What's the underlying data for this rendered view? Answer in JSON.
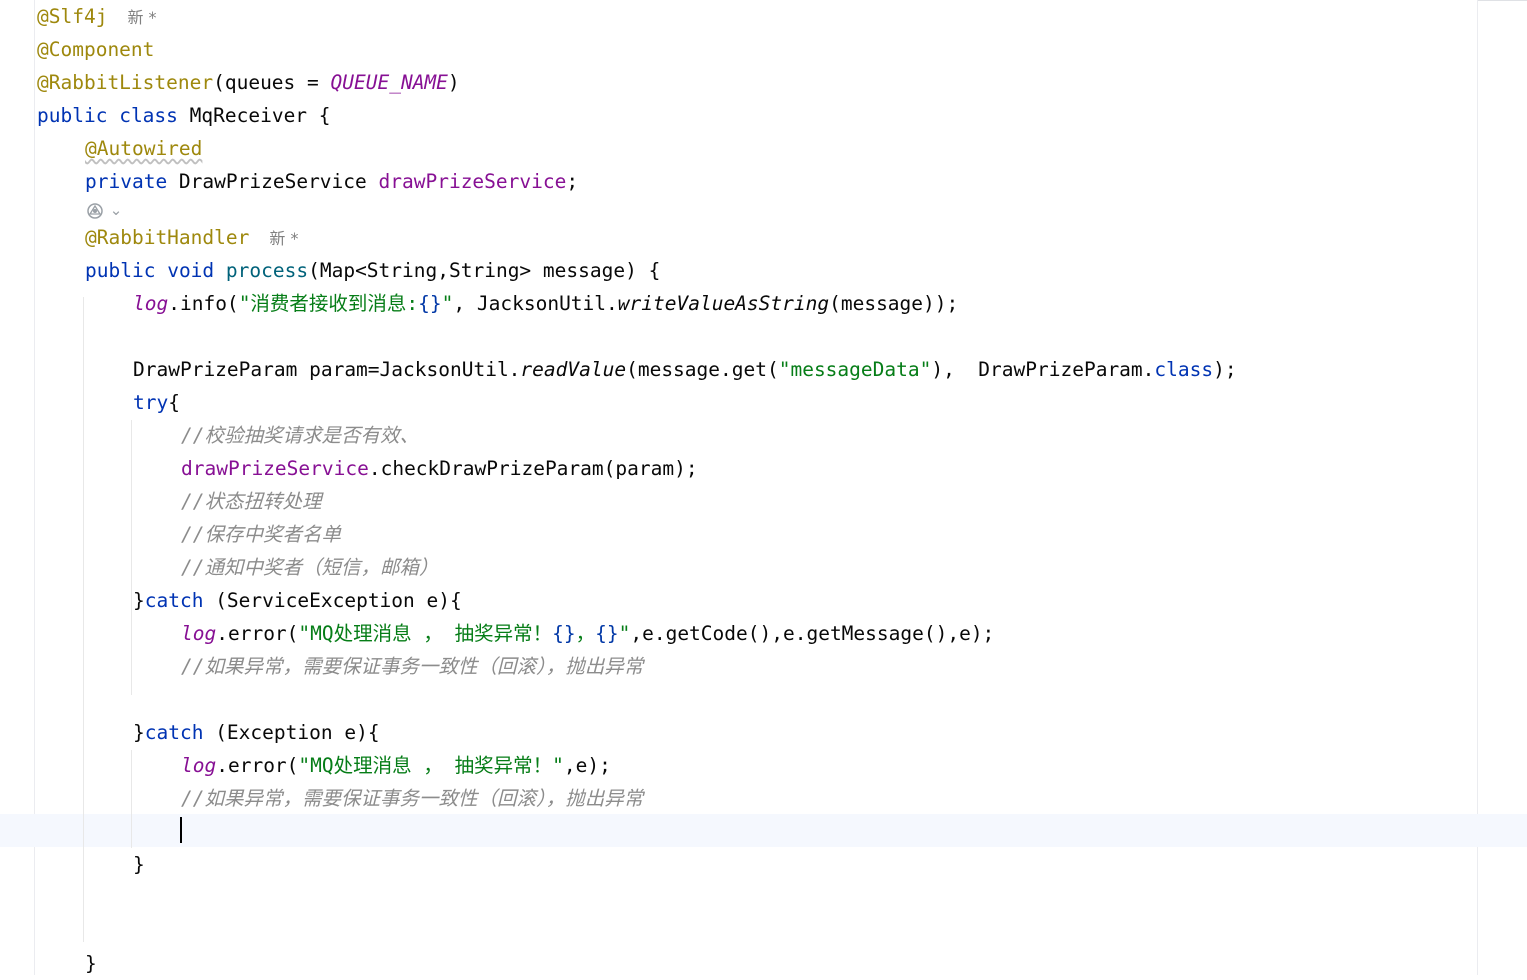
{
  "editor": {
    "inlay_new_1": "新 *",
    "inlay_new_2": "新 *",
    "lines": {
      "l1_ann": "@Slf4j",
      "l2_ann": "@Component",
      "l3_ann": "@RabbitListener",
      "l3_open": "(queues = ",
      "l3_const": "QUEUE_NAME",
      "l3_close": ")",
      "l4_kw1": "public",
      "l4_kw2": "class",
      "l4_name": " MqReceiver {",
      "l5_ann": "@Autowired",
      "l6_kw": "private",
      "l6_type": " DrawPrizeService ",
      "l6_field": "drawPrizeService",
      "l6_end": ";",
      "l7_ann": "@RabbitHandler",
      "l8_kw1": "public",
      "l8_kw2": "void",
      "l8_fn": "process",
      "l8_rest": "(Map<String,String> message) {",
      "l9_log": "log",
      "l9_a": ".info(",
      "l9_str": "\"消费者接收到消息:",
      "l9_esc": "{}",
      "l9_strend": "\"",
      "l9_b": ", JacksonUtil.",
      "l9_static": "writeValueAsString",
      "l9_c": "(message));",
      "l11_a": "DrawPrizeParam param=JacksonUtil.",
      "l11_static": "readValue",
      "l11_b": "(message.get(",
      "l11_str": "\"messageData\"",
      "l11_c": "),  DrawPrizeParam.",
      "l11_kw": "class",
      "l11_d": ");",
      "l12_kw": "try",
      "l12_rest": "{",
      "l13_cm": "//校验抽奖请求是否有效、",
      "l14_field": "drawPrizeService",
      "l14_rest": ".checkDrawPrizeParam(param);",
      "l15_cm": "//状态扭转处理",
      "l16_cm": "//保存中奖者名单",
      "l17_cm": "//通知中奖者（短信，邮箱）",
      "l18_a": "}",
      "l18_kw": "catch",
      "l18_b": " (ServiceException e){",
      "l19_log": "log",
      "l19_a": ".error(",
      "l19_str1": "\"MQ处理消息 ， 抽奖异常！",
      "l19_esc1": "{}",
      "l19_str2": "，",
      "l19_esc2": "{}",
      "l19_str3": "\"",
      "l19_b": ",e.getCode(),e.getMessage(),e);",
      "l20_cm": "//如果异常，需要保证事务一致性（回滚），抛出异常",
      "l22_a": "}",
      "l22_kw": "catch",
      "l22_b": " (Exception e){",
      "l23_log": "log",
      "l23_a": ".error(",
      "l23_str": "\"MQ处理消息 ， 抽奖异常！\"",
      "l23_b": ",e);",
      "l24_cm": "//如果异常，需要保证事务一致性（回滚），抛出异常",
      "l26_brace": "}",
      "l29_brace": "}"
    }
  },
  "gutter_icon": "spring-bean-icon",
  "colors": {
    "keyword": "#0033b3",
    "annotation": "#9e880d",
    "field": "#871094",
    "string": "#067d17",
    "comment": "#8c8c8c",
    "method_decl": "#00627a",
    "caret_row": "#f5f8fe"
  }
}
